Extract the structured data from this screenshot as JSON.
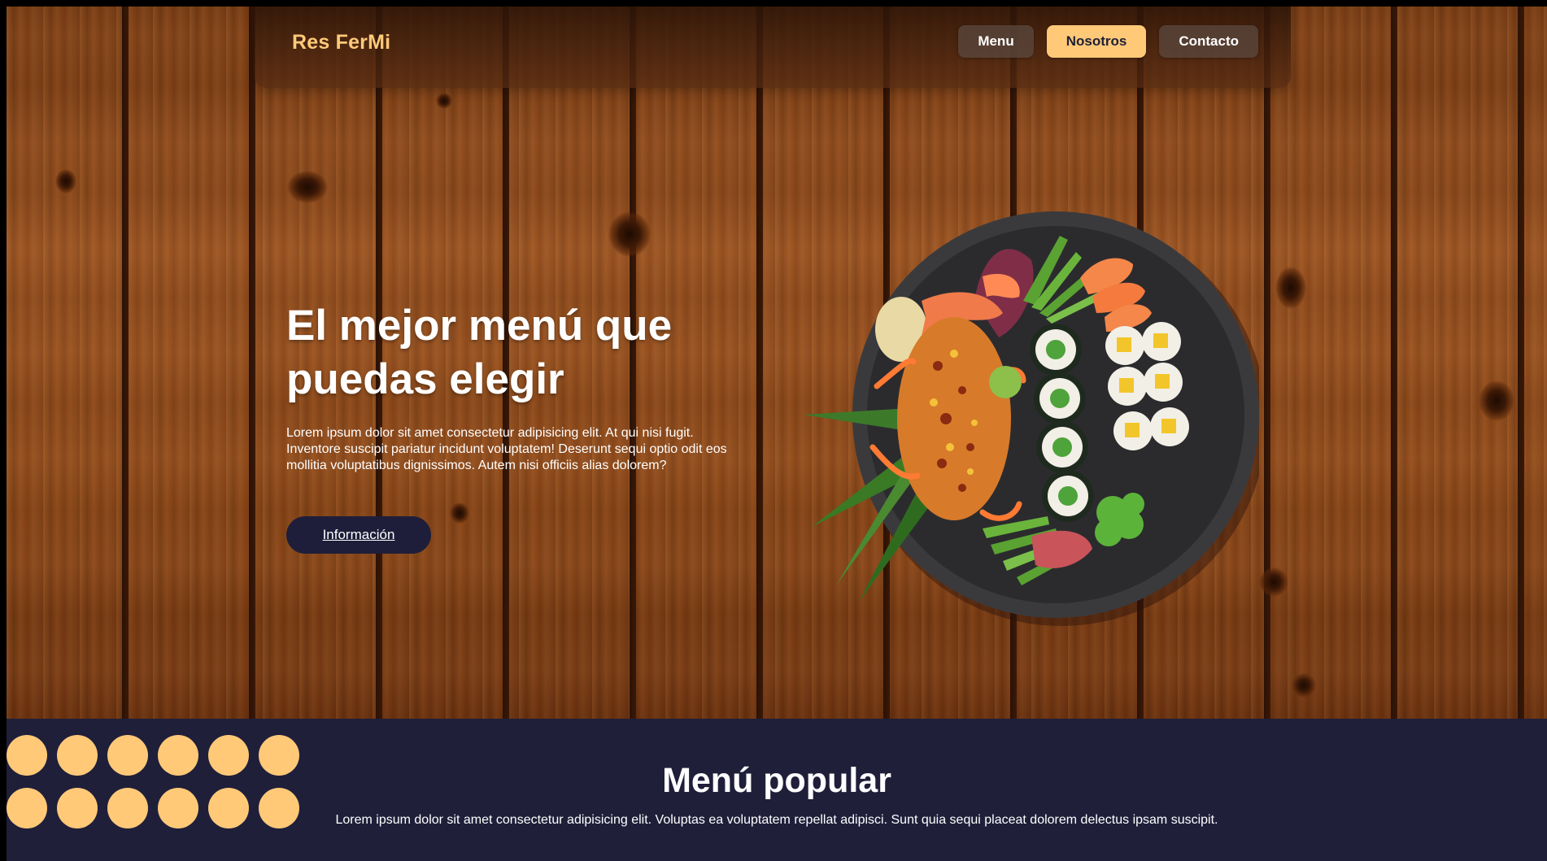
{
  "brand": {
    "name": "Res FerMi",
    "color": "#ffca7a"
  },
  "nav": {
    "items": [
      {
        "label": "Menu",
        "active": false
      },
      {
        "label": "Nosotros",
        "active": true
      },
      {
        "label": "Contacto",
        "active": false
      }
    ]
  },
  "hero": {
    "title_line1": "El mejor menú que",
    "title_line2": "puedas elegir",
    "description": "Lorem ipsum dolor sit amet consectetur adipisicing elit. At qui nisi fugit. Inventore suscipit pariatur incidunt voluptatem! Deserunt sequi optio odit eos mollitia voluptatibus dignissimos. Autem nisi officiis alias dolorem?",
    "button_label": "Información",
    "image_subject": "sushi-platter"
  },
  "popular": {
    "title": "Menú popular",
    "description": "Lorem ipsum dolor sit amet consectetur adipisicing elit. Voluptas ea voluptatem repellat adipisci. Sunt quia sequi placeat dolorem delectus ipsam suscipit."
  },
  "colors": {
    "accent": "#ffc978",
    "navy": "#1f1f3a",
    "wood": "#8a4618"
  }
}
